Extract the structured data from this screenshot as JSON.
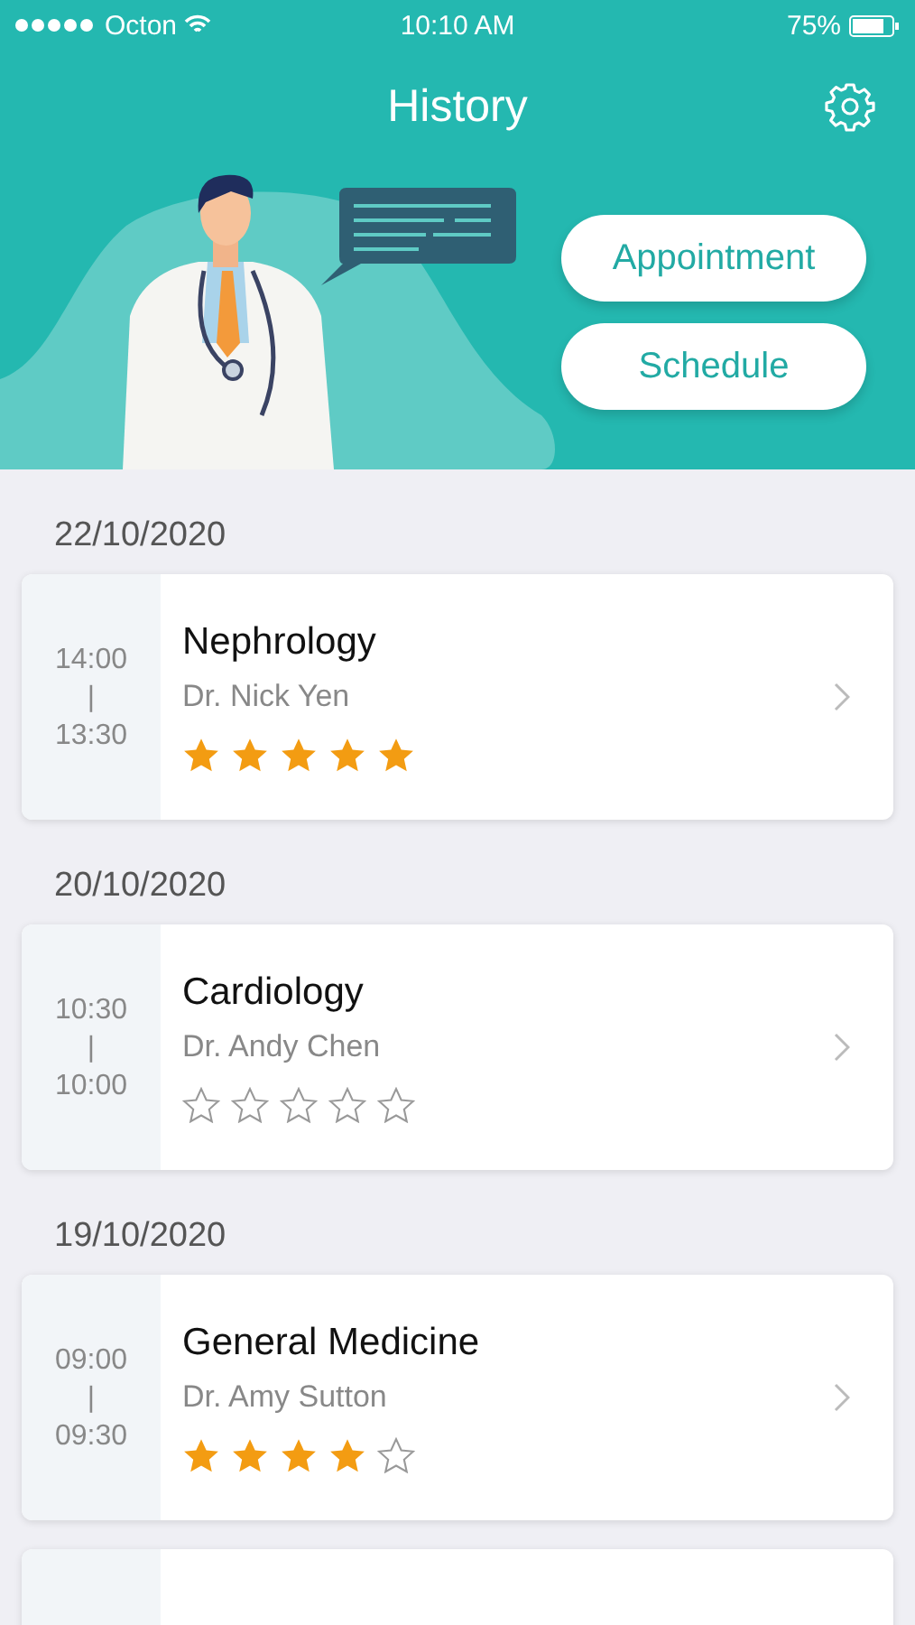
{
  "status_bar": {
    "carrier": "Octon",
    "time": "10:10 AM",
    "battery": "75%"
  },
  "header": {
    "title": "History"
  },
  "actions": [
    "Appointment",
    "Schedule"
  ],
  "visits": [
    {
      "date": "22/10/2020",
      "start": "14:00",
      "separator": "|",
      "end": "13:30",
      "department": "Nephrology",
      "doctor": "Dr. Nick Yen",
      "stars": 5
    },
    {
      "date": "20/10/2020",
      "start": "10:30",
      "separator": "|",
      "end": "10:00",
      "department": "Cardiology",
      "doctor": "Dr. Andy Chen",
      "stars": 0
    },
    {
      "date": "19/10/2020",
      "start": "09:00",
      "separator": "|",
      "end": "09:30",
      "department": "General Medicine",
      "doctor": "Dr. Amy Sutton",
      "stars": 4
    },
    {
      "kind": "partial"
    }
  ]
}
